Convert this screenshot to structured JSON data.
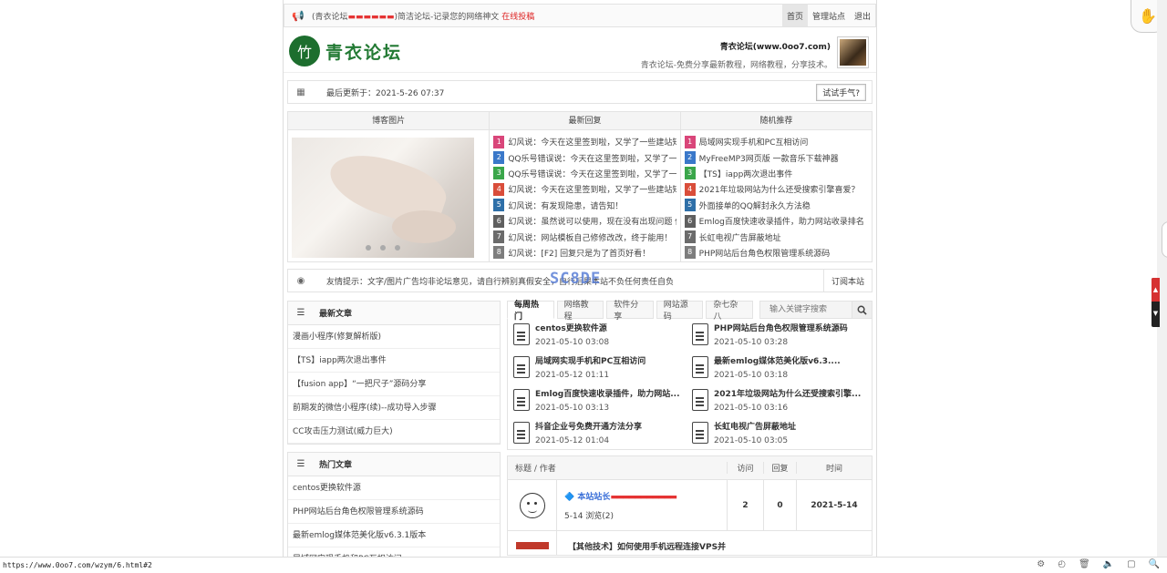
{
  "topbar": {
    "notice_prefix": "(青衣论坛",
    "notice_suffix": ")简洁论坛-记录您的网络神文",
    "notice_link": "在线投稿",
    "nav": [
      "首页",
      "管理站点",
      "退出"
    ]
  },
  "header": {
    "logo_text": "青衣论坛",
    "site_name": "青衣论坛(www.0oo7.com)",
    "site_desc": "青衣论坛-免费分享最新教程，网络教程，分享技术。"
  },
  "update": {
    "text": "最后更新于：2021-5-26 07:37",
    "button": "试试手气?"
  },
  "panels": {
    "titles": [
      "博客图片",
      "最新回复",
      "随机推荐"
    ],
    "recent_replies": [
      "幻风说：今天在这里签到啦，又学了一些建站知",
      "QQ乐号错误说：今天在这里签到啦，又学了一些",
      "QQ乐号错误说：今天在这里签到啦，又学了一些",
      "幻风说：今天在这里签到啦，又学了一些建站知",
      "幻风说：有发现隐患，请告知！",
      "幻风说：虽然说可以使用，现在没有出现问题 但",
      "幻风说：网站模板自己修修改改，终于能用！",
      "幻风说：[F2] 回复只是为了首页好看！"
    ],
    "random": [
      "局域网实现手机和PC互相访问",
      "MyFreeMP3网页版 一款音乐下载神器",
      "【TS】iapp两次退出事件",
      "2021年垃圾网站为什么还受搜索引擎喜爱？",
      "外面接单的QQ解封永久方法稳",
      "Emlog百度快速收录插件，助力网站收录排名",
      "长虹电视广告屏蔽地址",
      "PHP网站后台角色权限管理系统源码"
    ],
    "num_colors": [
      "#d9467a",
      "#3a78c9",
      "#3aa64a",
      "#d94d3a",
      "#2e6fa8",
      "#5f5f5f",
      "#6b6b6b",
      "#7d7d7d"
    ]
  },
  "tip": {
    "text": "友情提示：文字/图片广告均非论坛意见，请自行辨别真假安全，自行后果本站不负任何责任自负",
    "subscribe": "订阅本站",
    "watermark": "SC8DE"
  },
  "latest": {
    "title": "最新文章",
    "items": [
      "漫画小程序(修复解析版)",
      "【TS】iapp两次退出事件",
      "【fusion app】“一把尺子”源码分享",
      "前期发的微信小程序(续)--成功导入步骤",
      "CC攻击压力测试(威力巨大)"
    ]
  },
  "hot": {
    "title": "热门文章",
    "items": [
      "centos更换软件源",
      "PHP网站后台角色权限管理系统源码",
      "最新emlog媒体范美化版v6.3.1版本",
      "局域网实现手机和PC互相访问"
    ]
  },
  "tabs": {
    "items": [
      "每周热门",
      "网络教程",
      "软件分享",
      "网站源码",
      "杂七杂八"
    ],
    "search_placeholder": "输入关键字搜索"
  },
  "articles": [
    {
      "title": "centos更换软件源",
      "date": "2021-05-10 03:08"
    },
    {
      "title": "PHP网站后台角色权限管理系统源码",
      "date": "2021-05-10 03:28"
    },
    {
      "title": "局域网实现手机和PC互相访问",
      "date": "2021-05-12 01:11"
    },
    {
      "title": "最新emlog媒体范美化版v6.3....",
      "date": "2021-05-10 03:18"
    },
    {
      "title": "Emlog百度快速收录插件，助力网站...",
      "date": "2021-05-10 03:13"
    },
    {
      "title": "2021年垃圾网站为什么还受搜索引擎...",
      "date": "2021-05-10 03:16"
    },
    {
      "title": "抖音企业号免费开通方法分享",
      "date": "2021-05-12 01:04"
    },
    {
      "title": "长虹电视广告屏蔽地址",
      "date": "2021-05-10 03:05"
    }
  ],
  "table": {
    "headers": [
      "标题 / 作者",
      "访问",
      "回复",
      "时间"
    ],
    "row1": {
      "title_prefix": "本站站长",
      "meta": "5-14    浏览(2)",
      "visits": "2",
      "replies": "0",
      "time": "2021-5-14"
    },
    "row2": {
      "title": "【其他技术】如何使用手机远程连接VPS并"
    }
  },
  "status": {
    "url": "https://www.0oo7.com/wzym/6.html#2"
  }
}
